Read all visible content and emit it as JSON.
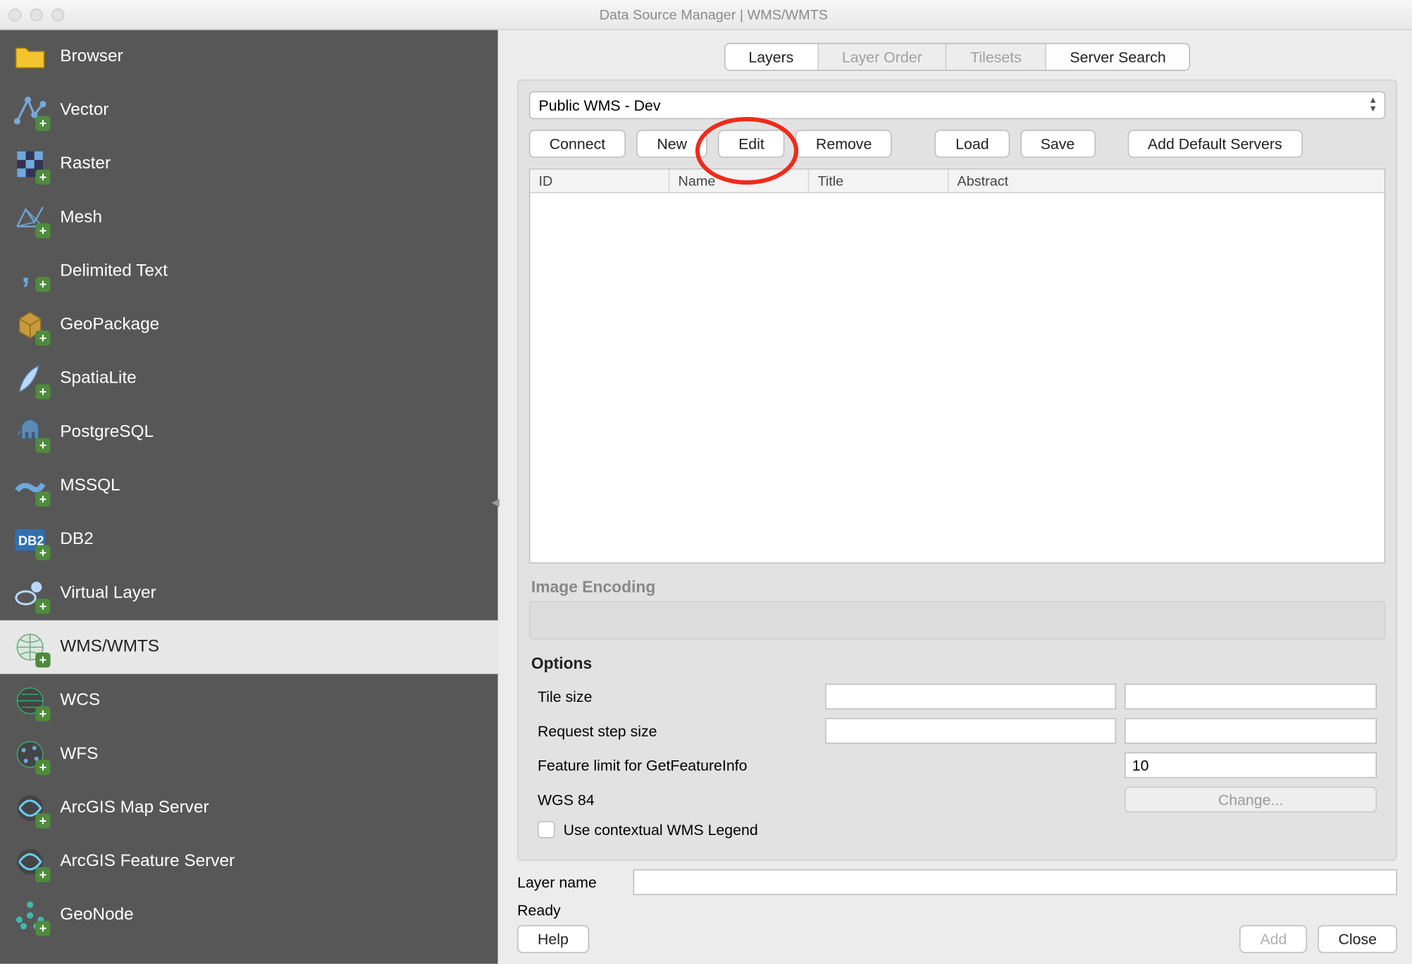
{
  "window": {
    "title": "Data Source Manager | WMS/WMTS"
  },
  "sidebar": {
    "items": [
      {
        "label": "Browser",
        "icon": "folder",
        "selected": false
      },
      {
        "label": "Vector",
        "icon": "vector",
        "selected": false
      },
      {
        "label": "Raster",
        "icon": "raster",
        "selected": false
      },
      {
        "label": "Mesh",
        "icon": "mesh",
        "selected": false
      },
      {
        "label": "Delimited Text",
        "icon": "comma",
        "selected": false
      },
      {
        "label": "GeoPackage",
        "icon": "geopackage",
        "selected": false
      },
      {
        "label": "SpatiaLite",
        "icon": "feather",
        "selected": false
      },
      {
        "label": "PostgreSQL",
        "icon": "elephant",
        "selected": false
      },
      {
        "label": "MSSQL",
        "icon": "mssql",
        "selected": false
      },
      {
        "label": "DB2",
        "icon": "db2",
        "selected": false
      },
      {
        "label": "Virtual Layer",
        "icon": "virtual",
        "selected": false
      },
      {
        "label": "WMS/WMTS",
        "icon": "globe-grid",
        "selected": true
      },
      {
        "label": "WCS",
        "icon": "globe-lines",
        "selected": false
      },
      {
        "label": "WFS",
        "icon": "globe-dots",
        "selected": false
      },
      {
        "label": "ArcGIS Map Server",
        "icon": "globe-swirl",
        "selected": false
      },
      {
        "label": "ArcGIS Feature Server",
        "icon": "globe-swirl",
        "selected": false
      },
      {
        "label": "GeoNode",
        "icon": "geonode",
        "selected": false
      }
    ]
  },
  "tabs": [
    {
      "label": "Layers",
      "state": "active"
    },
    {
      "label": "Layer Order",
      "state": "inactive"
    },
    {
      "label": "Tilesets",
      "state": "inactive"
    },
    {
      "label": "Server Search",
      "state": "normal"
    }
  ],
  "connection": {
    "selected": "Public WMS - Dev"
  },
  "buttons": {
    "connect": "Connect",
    "new": "New",
    "edit": "Edit",
    "remove": "Remove",
    "load": "Load",
    "save": "Save",
    "add_default": "Add Default Servers"
  },
  "highlight": "new",
  "table": {
    "columns": [
      "ID",
      "Name",
      "Title",
      "Abstract"
    ],
    "widths": [
      130,
      130,
      130,
      380
    ]
  },
  "sections": {
    "image_encoding": "Image Encoding",
    "options": "Options"
  },
  "options": {
    "tile_size_label": "Tile size",
    "tile_size_a": "",
    "tile_size_b": "",
    "step_size_label": "Request step size",
    "step_size_a": "",
    "step_size_b": "",
    "feature_limit_label": "Feature limit for GetFeatureInfo",
    "feature_limit_value": "10",
    "crs_label": "WGS 84",
    "change_label": "Change...",
    "contextual_legend_label": "Use contextual WMS Legend",
    "contextual_legend_checked": false
  },
  "bottom": {
    "layer_name_label": "Layer name",
    "layer_name_value": "",
    "status": "Ready",
    "help": "Help",
    "add": "Add",
    "close": "Close"
  }
}
